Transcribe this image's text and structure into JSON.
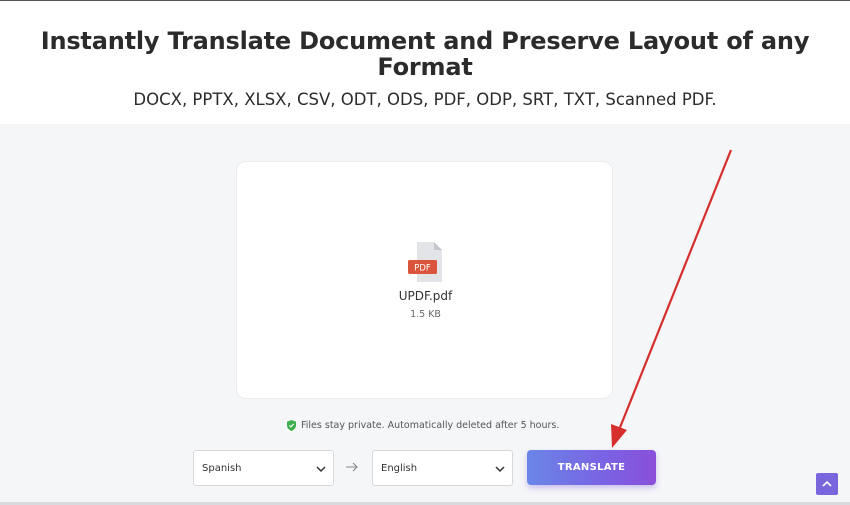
{
  "header": {
    "title": "Instantly Translate Document and Preserve Layout of any Format",
    "subtitle": "DOCX, PPTX, XLSX, CSV, ODT, ODS, PDF, ODP, SRT, TXT, Scanned PDF."
  },
  "upload": {
    "file_type_badge": "PDF",
    "file_name": "UPDF.pdf",
    "file_size": "1.5 KB"
  },
  "privacy_note": "Files stay private. Automatically deleted after 5 hours.",
  "languages": {
    "source": "Spanish",
    "target": "English"
  },
  "actions": {
    "translate_label": "TRANSLATE"
  },
  "colors": {
    "accent_start": "#6a86e6",
    "accent_end": "#8a4fd9",
    "pdf_badge": "#d9553b",
    "annotation_arrow": "#d62d2d",
    "shield": "#3fae4e"
  },
  "icons": {
    "file": "pdf-file-icon",
    "privacy": "shield-check-icon",
    "dropdown": "chevron-down-icon",
    "swap": "arrow-right-icon",
    "scroll": "chevron-up-icon"
  }
}
